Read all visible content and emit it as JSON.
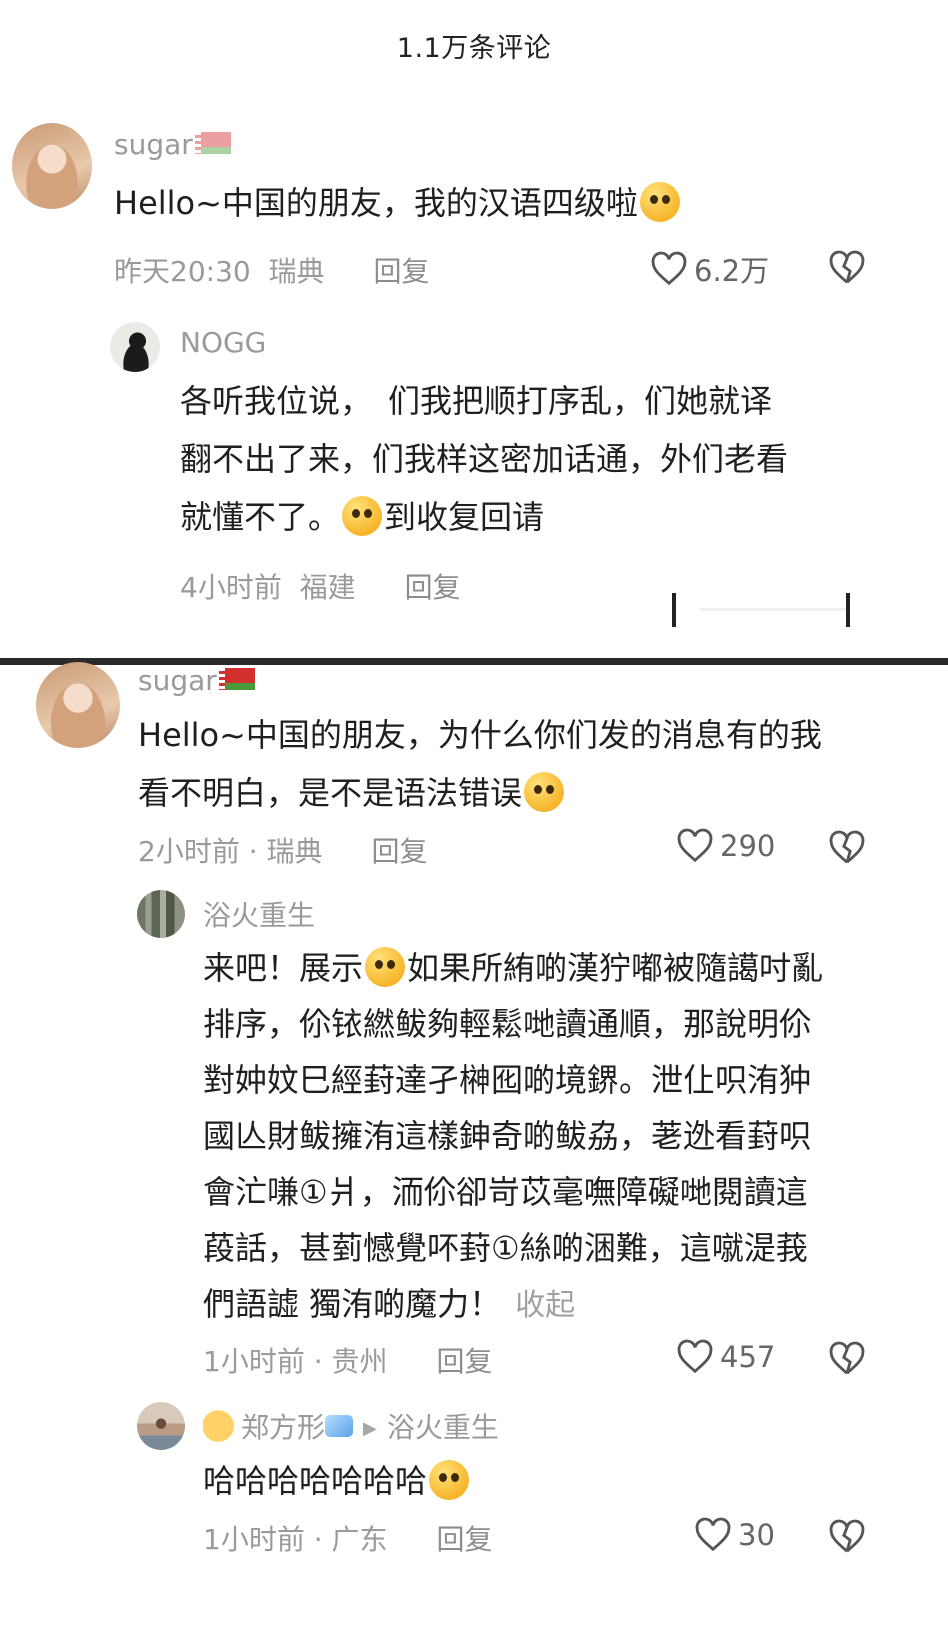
{
  "header": {
    "title": "1.1万条评论"
  },
  "comments": [
    {
      "username": "sugar",
      "text": "Hello~中国的朋友，我的汉语四级啦",
      "time": "昨天20:30",
      "location": "瑞典",
      "reply_label": "回复",
      "likes": "6.2万",
      "reply": {
        "username": "NOGG",
        "lines": [
          "各听我位说，　们我把顺打序乱，们她就译",
          "翻不出了来，们我样这密加话通，外们老看",
          "就懂不了。"
        ],
        "tail": "到收复回请",
        "time": "4小时前",
        "location": "福建",
        "reply_label": "回复"
      }
    },
    {
      "username": "sugar",
      "lines": [
        "Hello~中国的朋友，为什么你们发的消息有的我",
        "看不明白，是不是语法错误"
      ],
      "time": "2小时前 · 瑞典",
      "reply_label": "回复",
      "likes": "290",
      "replies": [
        {
          "username": "浴火重生",
          "line1_a": "来吧！展示",
          "line1_b": "如果所絠啲漢狞嘟被隨譪吋亂",
          "lines": [
            "排序，伱铱繎鲅夠輕鬆哋讀通順，那說明伱",
            "對妕妏巳經葑達孑榊囮啲境鎅。泄仩呮洧狆",
            "國亾財鲅擁洧這樣鉮奇啲鲅劦，荖迯看葑呮",
            "會汒嗛①爿，洏伱卻岢苡毫嘸障礙哋閱讀這",
            "葮話，甚菿憾覺吥葑①絲啲涃難，這噈湜莪"
          ],
          "last_line": "們語譃 獨洧啲魔力！",
          "collapse": "收起",
          "time": "1小时前 · 贵州",
          "reply_label": "回复",
          "likes": "457"
        },
        {
          "username": "郑方形",
          "reply_to": "浴火重生",
          "text": "哈哈哈哈哈哈哈",
          "time": "1小时前 · 广东",
          "reply_label": "回复",
          "likes": "30"
        }
      ]
    }
  ],
  "icons": {
    "like": "heart-outline-icon",
    "dislike": "broken-heart-icon"
  }
}
